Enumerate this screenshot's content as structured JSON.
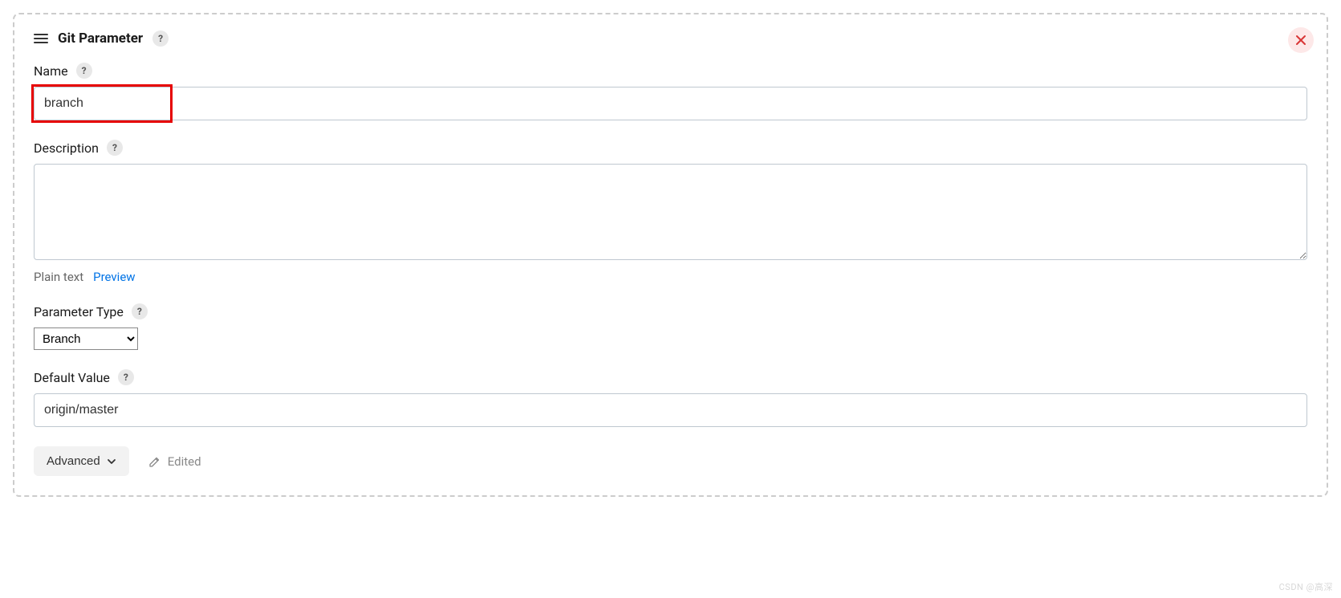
{
  "panel": {
    "title": "Git Parameter"
  },
  "fields": {
    "name": {
      "label": "Name",
      "value": "branch"
    },
    "description": {
      "label": "Description",
      "value": "",
      "plain_text_label": "Plain text",
      "preview_label": "Preview"
    },
    "parameter_type": {
      "label": "Parameter Type",
      "selected": "Branch"
    },
    "default_value": {
      "label": "Default Value",
      "value": "origin/master"
    }
  },
  "footer": {
    "advanced_label": "Advanced",
    "edited_label": "Edited"
  },
  "icons": {
    "help": "?"
  },
  "watermark": "CSDN @高深"
}
